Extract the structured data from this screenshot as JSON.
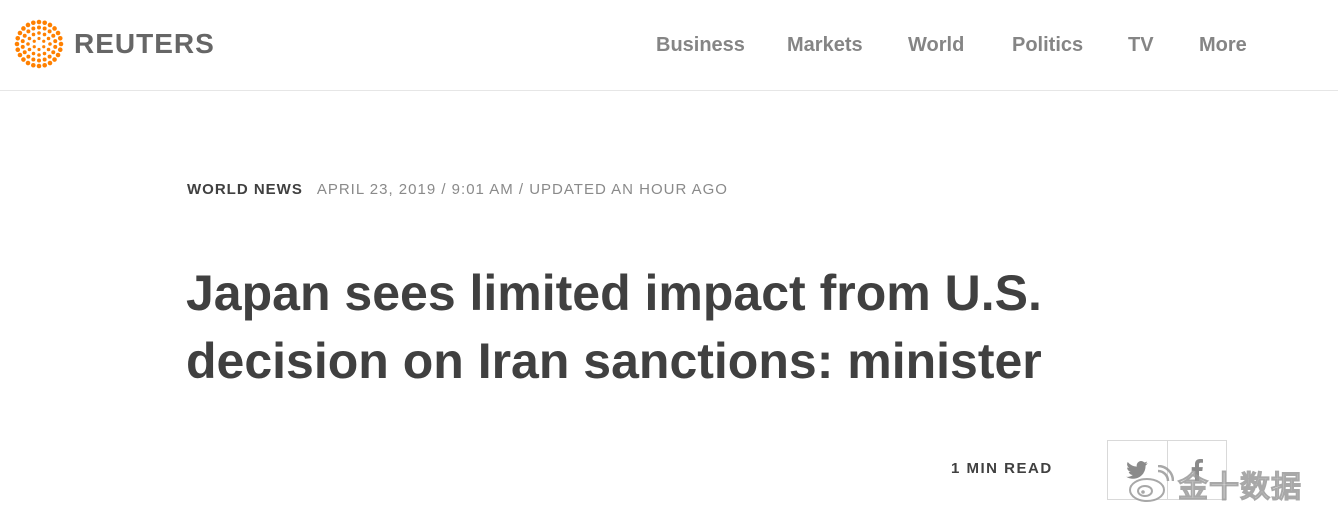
{
  "header": {
    "brand": "REUTERS",
    "logo_color": "#ff8000",
    "nav": [
      {
        "label": "Business",
        "name": "nav-business"
      },
      {
        "label": "Markets",
        "name": "nav-markets"
      },
      {
        "label": "World",
        "name": "nav-world"
      },
      {
        "label": "Politics",
        "name": "nav-politics"
      },
      {
        "label": "TV",
        "name": "nav-tv"
      },
      {
        "label": "More",
        "name": "nav-more"
      }
    ]
  },
  "article": {
    "section": "WORLD NEWS",
    "dateline": "APRIL 23, 2019 / 9:01 AM / UPDATED AN HOUR AGO",
    "headline": "Japan sees limited impact from U.S. decision on Iran sanctions: minister",
    "read_time": "1 MIN READ"
  },
  "share": {
    "icons": [
      "twitter-icon",
      "facebook-icon"
    ]
  },
  "watermark": {
    "text": "金十数据",
    "icon": "weibo-icon"
  }
}
